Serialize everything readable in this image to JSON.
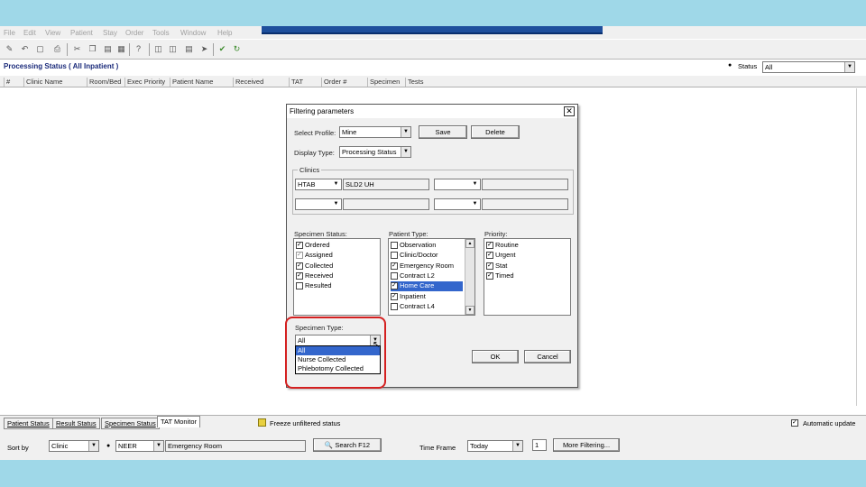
{
  "menu": [
    "File",
    "Edit",
    "View",
    "Patient",
    "Stay",
    "Order",
    "Tools",
    "Window",
    "Help"
  ],
  "main": {
    "heading": "Processing Status ( All Inpatient )",
    "status_label": "Status",
    "status_value": "All",
    "columns": [
      "#",
      "Clinic Name",
      "Room/Bed",
      "Exec Priority",
      "Patient Name",
      "Received",
      "TAT",
      "Order #",
      "Specimen",
      "Tests"
    ]
  },
  "dialog": {
    "title": "Filtering parameters",
    "select_profile_label": "Select Profile:",
    "select_profile_value": "Mine",
    "save_label": "Save",
    "delete_label": "Delete",
    "display_type_label": "Display Type:",
    "display_type_value": "Processing Status",
    "clinics_label": "Clinics",
    "clinic_code": "HTAB",
    "clinic_name": "SLD2 UH",
    "specimen_status_label": "Specimen Status:",
    "specimen_status": [
      {
        "label": "Ordered",
        "checked": true,
        "gray": false
      },
      {
        "label": "Assigned",
        "checked": true,
        "gray": true
      },
      {
        "label": "Collected",
        "checked": true,
        "gray": false
      },
      {
        "label": "Received",
        "checked": true,
        "gray": false
      },
      {
        "label": "Resulted",
        "checked": false,
        "gray": false
      }
    ],
    "patient_type_label": "Patient Type:",
    "patient_type": [
      {
        "label": "Observation",
        "checked": false
      },
      {
        "label": "Clinic/Doctor",
        "checked": false
      },
      {
        "label": "Emergency Room",
        "checked": true
      },
      {
        "label": "Contract L2",
        "checked": false
      },
      {
        "label": "Home Care",
        "checked": true,
        "selected": true
      },
      {
        "label": "Inpatient",
        "checked": true
      },
      {
        "label": "Contract L4",
        "checked": false
      }
    ],
    "priority_label": "Priority:",
    "priority": [
      {
        "label": "Routine",
        "checked": true
      },
      {
        "label": "Urgent",
        "checked": true
      },
      {
        "label": "Stat",
        "checked": true
      },
      {
        "label": "Timed",
        "checked": true
      }
    ],
    "specimen_type_label": "Specimen Type:",
    "specimen_type_value": "All",
    "specimen_type_options": [
      "All",
      "Nurse Collected",
      "Phlebotomy Collected"
    ],
    "ok_label": "OK",
    "cancel_label": "Cancel"
  },
  "bottom": {
    "tabs": [
      "Patient Status",
      "Result Status",
      "Specimen Status",
      "TAT Monitor"
    ],
    "freeze_label": "Freeze unfiltered status",
    "auto_update_label": "Automatic update",
    "sort_by_label": "Sort by",
    "sort_by_value": "Clinic",
    "patient_field": "NEER",
    "patient_name": "Emergency Room",
    "search_label": "Search F12",
    "time_frame_label": "Time Frame",
    "time_frame_value": "Today",
    "count_value": "1",
    "more_filtering_label": "More Filtering..."
  }
}
